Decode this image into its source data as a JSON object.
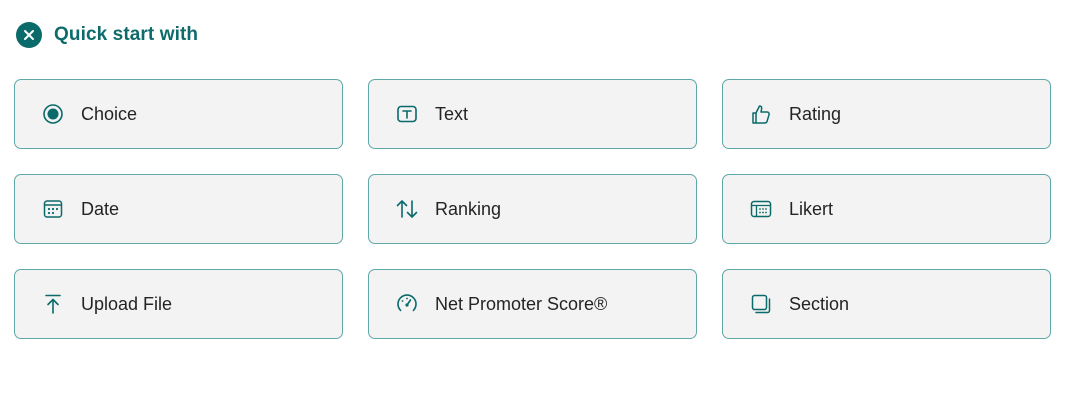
{
  "header": {
    "title": "Quick start with",
    "close_icon": "close-icon"
  },
  "colors": {
    "accent": "#0b6a6a",
    "tile_background": "#f3f3f3",
    "tile_border": "#5fa8a8",
    "label_text": "#242424"
  },
  "tiles": [
    {
      "label": "Choice",
      "icon": "radio-button-icon"
    },
    {
      "label": "Text",
      "icon": "text-box-icon"
    },
    {
      "label": "Rating",
      "icon": "thumbs-up-icon"
    },
    {
      "label": "Date",
      "icon": "calendar-icon"
    },
    {
      "label": "Ranking",
      "icon": "sort-arrows-icon"
    },
    {
      "label": "Likert",
      "icon": "likert-table-icon"
    },
    {
      "label": "Upload File",
      "icon": "upload-icon"
    },
    {
      "label": "Net Promoter Score®",
      "icon": "gauge-icon"
    },
    {
      "label": "Section",
      "icon": "section-pages-icon"
    }
  ]
}
